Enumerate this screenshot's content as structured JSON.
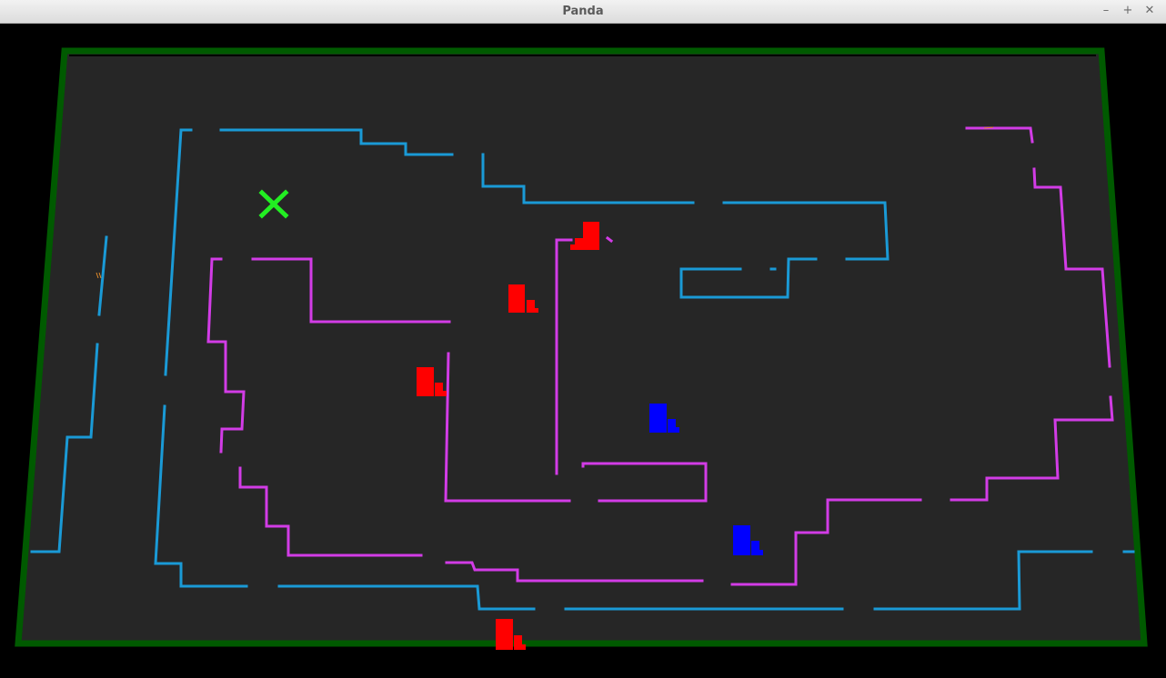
{
  "window": {
    "title": "Panda",
    "minimize_icon": "minimize-icon",
    "maximize_icon": "maximize-icon",
    "close_icon": "close-icon",
    "minimize_glyph": "–",
    "maximize_glyph": "+",
    "close_glyph": "✕"
  },
  "scene": {
    "board_color": "#262626",
    "border_color": "#005a00",
    "outer_maze_color": "#1a9ad6",
    "inner_maze_color": "#d23ce6",
    "goal_marker_color": "#22ee22",
    "red_team_color": "#ff0000",
    "blue_team_color": "#0000ff",
    "red_agents": 4,
    "blue_agents": 2
  }
}
